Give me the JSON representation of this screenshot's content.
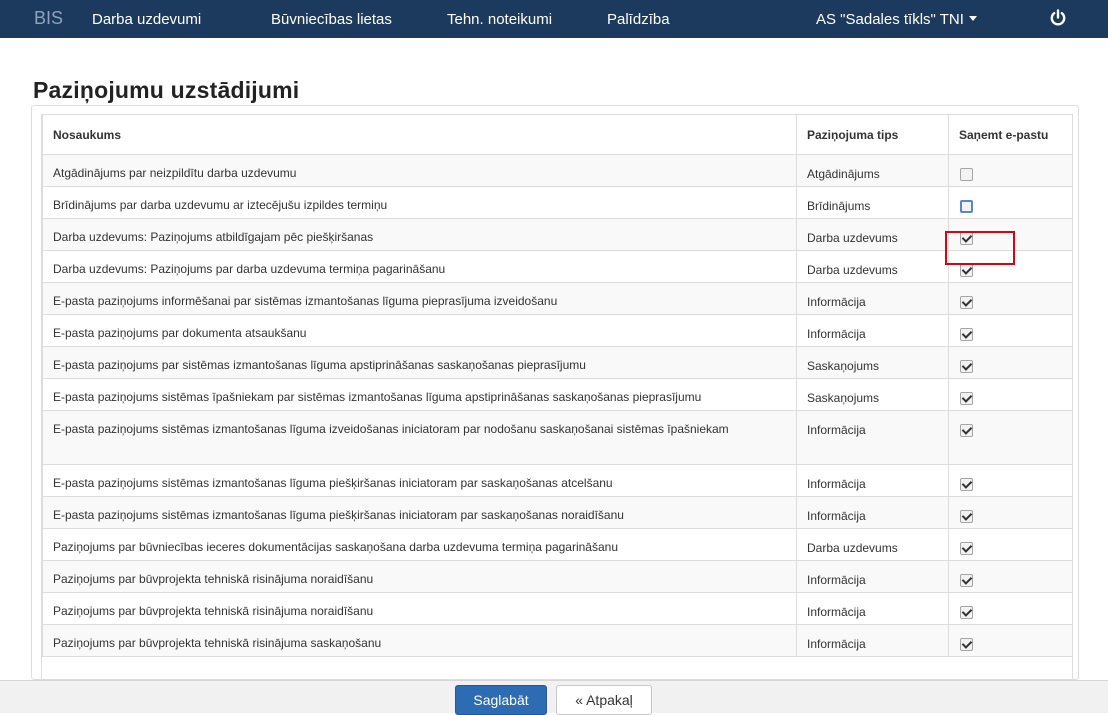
{
  "nav": {
    "brand": "BIS",
    "items": [
      "Darba uzdevumi",
      "Būvniecības lietas",
      "Tehn. noteikumi",
      "Palīdzība"
    ],
    "org": "AS \"Sadales tīkls\" TNI"
  },
  "page_title": "Paziņojumu uzstādijumi",
  "table": {
    "headers": [
      "Nosaukums",
      "Paziņojuma tips",
      "Saņemt e-pastu"
    ],
    "rows": [
      {
        "name": "Atgādinājums par neizpildītu darba uzdevumu",
        "type": "Atgādinājums",
        "email": false
      },
      {
        "name": "Brīdinājums par darba uzdevumu ar iztecējušu izpildes termiņu",
        "type": "Brīdinājums",
        "email": false
      },
      {
        "name": "Darba uzdevums: Paziņojums atbildīgajam pēc piešķiršanas",
        "type": "Darba uzdevums",
        "email": true
      },
      {
        "name": "Darba uzdevums: Paziņojums par darba uzdevuma termiņa pagarināšanu",
        "type": "Darba uzdevums",
        "email": true
      },
      {
        "name": "E-pasta paziņojums informēšanai par sistēmas izmantošanas līguma pieprasījuma izveidošanu",
        "type": "Informācija",
        "email": true
      },
      {
        "name": "E-pasta paziņojums par dokumenta atsaukšanu",
        "type": "Informācija",
        "email": true
      },
      {
        "name": "E-pasta paziņojums par sistēmas izmantošanas līguma apstiprināšanas saskaņošanas pieprasījumu",
        "type": "Saskaņojums",
        "email": true
      },
      {
        "name": "E-pasta paziņojums sistēmas īpašniekam par sistēmas izmantošanas līguma apstiprināšanas saskaņošanas pieprasījumu",
        "type": "Saskaņojums",
        "email": true
      },
      {
        "name": "E-pasta paziņojums sistēmas izmantošanas līguma izveidošanas iniciatoram par nodošanu saskaņošanai sistēmas īpašniekam",
        "type": "Informācija",
        "email": true
      },
      {
        "name": "E-pasta paziņojums sistēmas izmantošanas līguma piešķiršanas iniciatoram par saskaņošanas atcelšanu",
        "type": "Informācija",
        "email": true
      },
      {
        "name": "E-pasta paziņojums sistēmas izmantošanas līguma piešķiršanas iniciatoram par saskaņošanas noraidīšanu",
        "type": "Informācija",
        "email": true
      },
      {
        "name": "Paziņojums par būvniecības ieceres dokumentācijas saskaņošana darba uzdevuma termiņa pagarināšanu",
        "type": "Darba uzdevums",
        "email": true
      },
      {
        "name": "Paziņojums par būvprojekta tehniskā risinājuma noraidīšanu",
        "type": "Informācija",
        "email": true
      },
      {
        "name": "Paziņojums par būvprojekta tehniskā risinājuma noraidīšanu",
        "type": "Informācija",
        "email": true
      },
      {
        "name": "Paziņojums par būvprojekta tehniskā risinājuma saskaņošanu",
        "type": "Informācija",
        "email": true
      }
    ]
  },
  "footer": {
    "save_label": "Saglabāt",
    "back_label": "« Atpakaļ"
  }
}
